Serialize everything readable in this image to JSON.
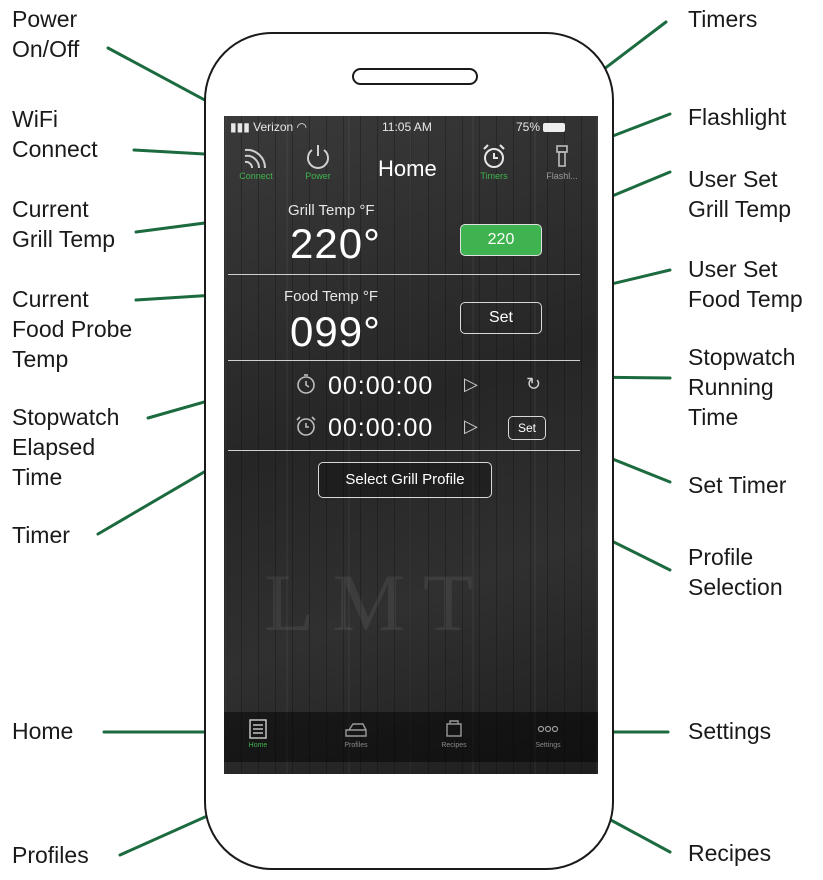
{
  "callouts": {
    "power": "Power\nOn/Off",
    "wifi": "WiFi\nConnect",
    "grill": "Current\nGrill Temp",
    "food": "Current\nFood Probe\nTemp",
    "stopwatch": "Stopwatch\nElapsed\nTime",
    "timer": "Timer",
    "home": "Home",
    "profiles": "Profiles",
    "timers": "Timers",
    "flashlight": "Flashlight",
    "user_grill": "User Set\nGrill Temp",
    "user_food": "User Set\nFood Temp",
    "running": "Stopwatch\nRunning\nTime",
    "set_timer": "Set Timer",
    "profile_sel": "Profile\nSelection",
    "settings": "Settings",
    "recipes": "Recipes"
  },
  "status_bar": {
    "carrier": "Verizon",
    "time": "11:05 AM",
    "battery": "75%"
  },
  "top_bar": {
    "title": "Home",
    "connect_label": "Connect",
    "power_label": "Power",
    "timers_label": "Timers",
    "flash_label": "Flashl..."
  },
  "grill": {
    "label": "Grill Temp °F",
    "value": "220°",
    "set_value": "220"
  },
  "food": {
    "label": "Food Temp °F",
    "value": "099°",
    "set_label": "Set"
  },
  "stopwatch": {
    "time": "00:00:00"
  },
  "timer": {
    "time": "00:00:00",
    "set_label": "Set"
  },
  "profile_button": "Select Grill Profile",
  "watermark": "LMT",
  "tabs": {
    "home": "Home",
    "profiles": "Profiles",
    "recipes": "Recipes",
    "settings": "Settings"
  },
  "colors": {
    "accent_green": "#3fb34f",
    "leader_green": "#1b6b3f",
    "screen_bg": "#2a2a2a"
  }
}
